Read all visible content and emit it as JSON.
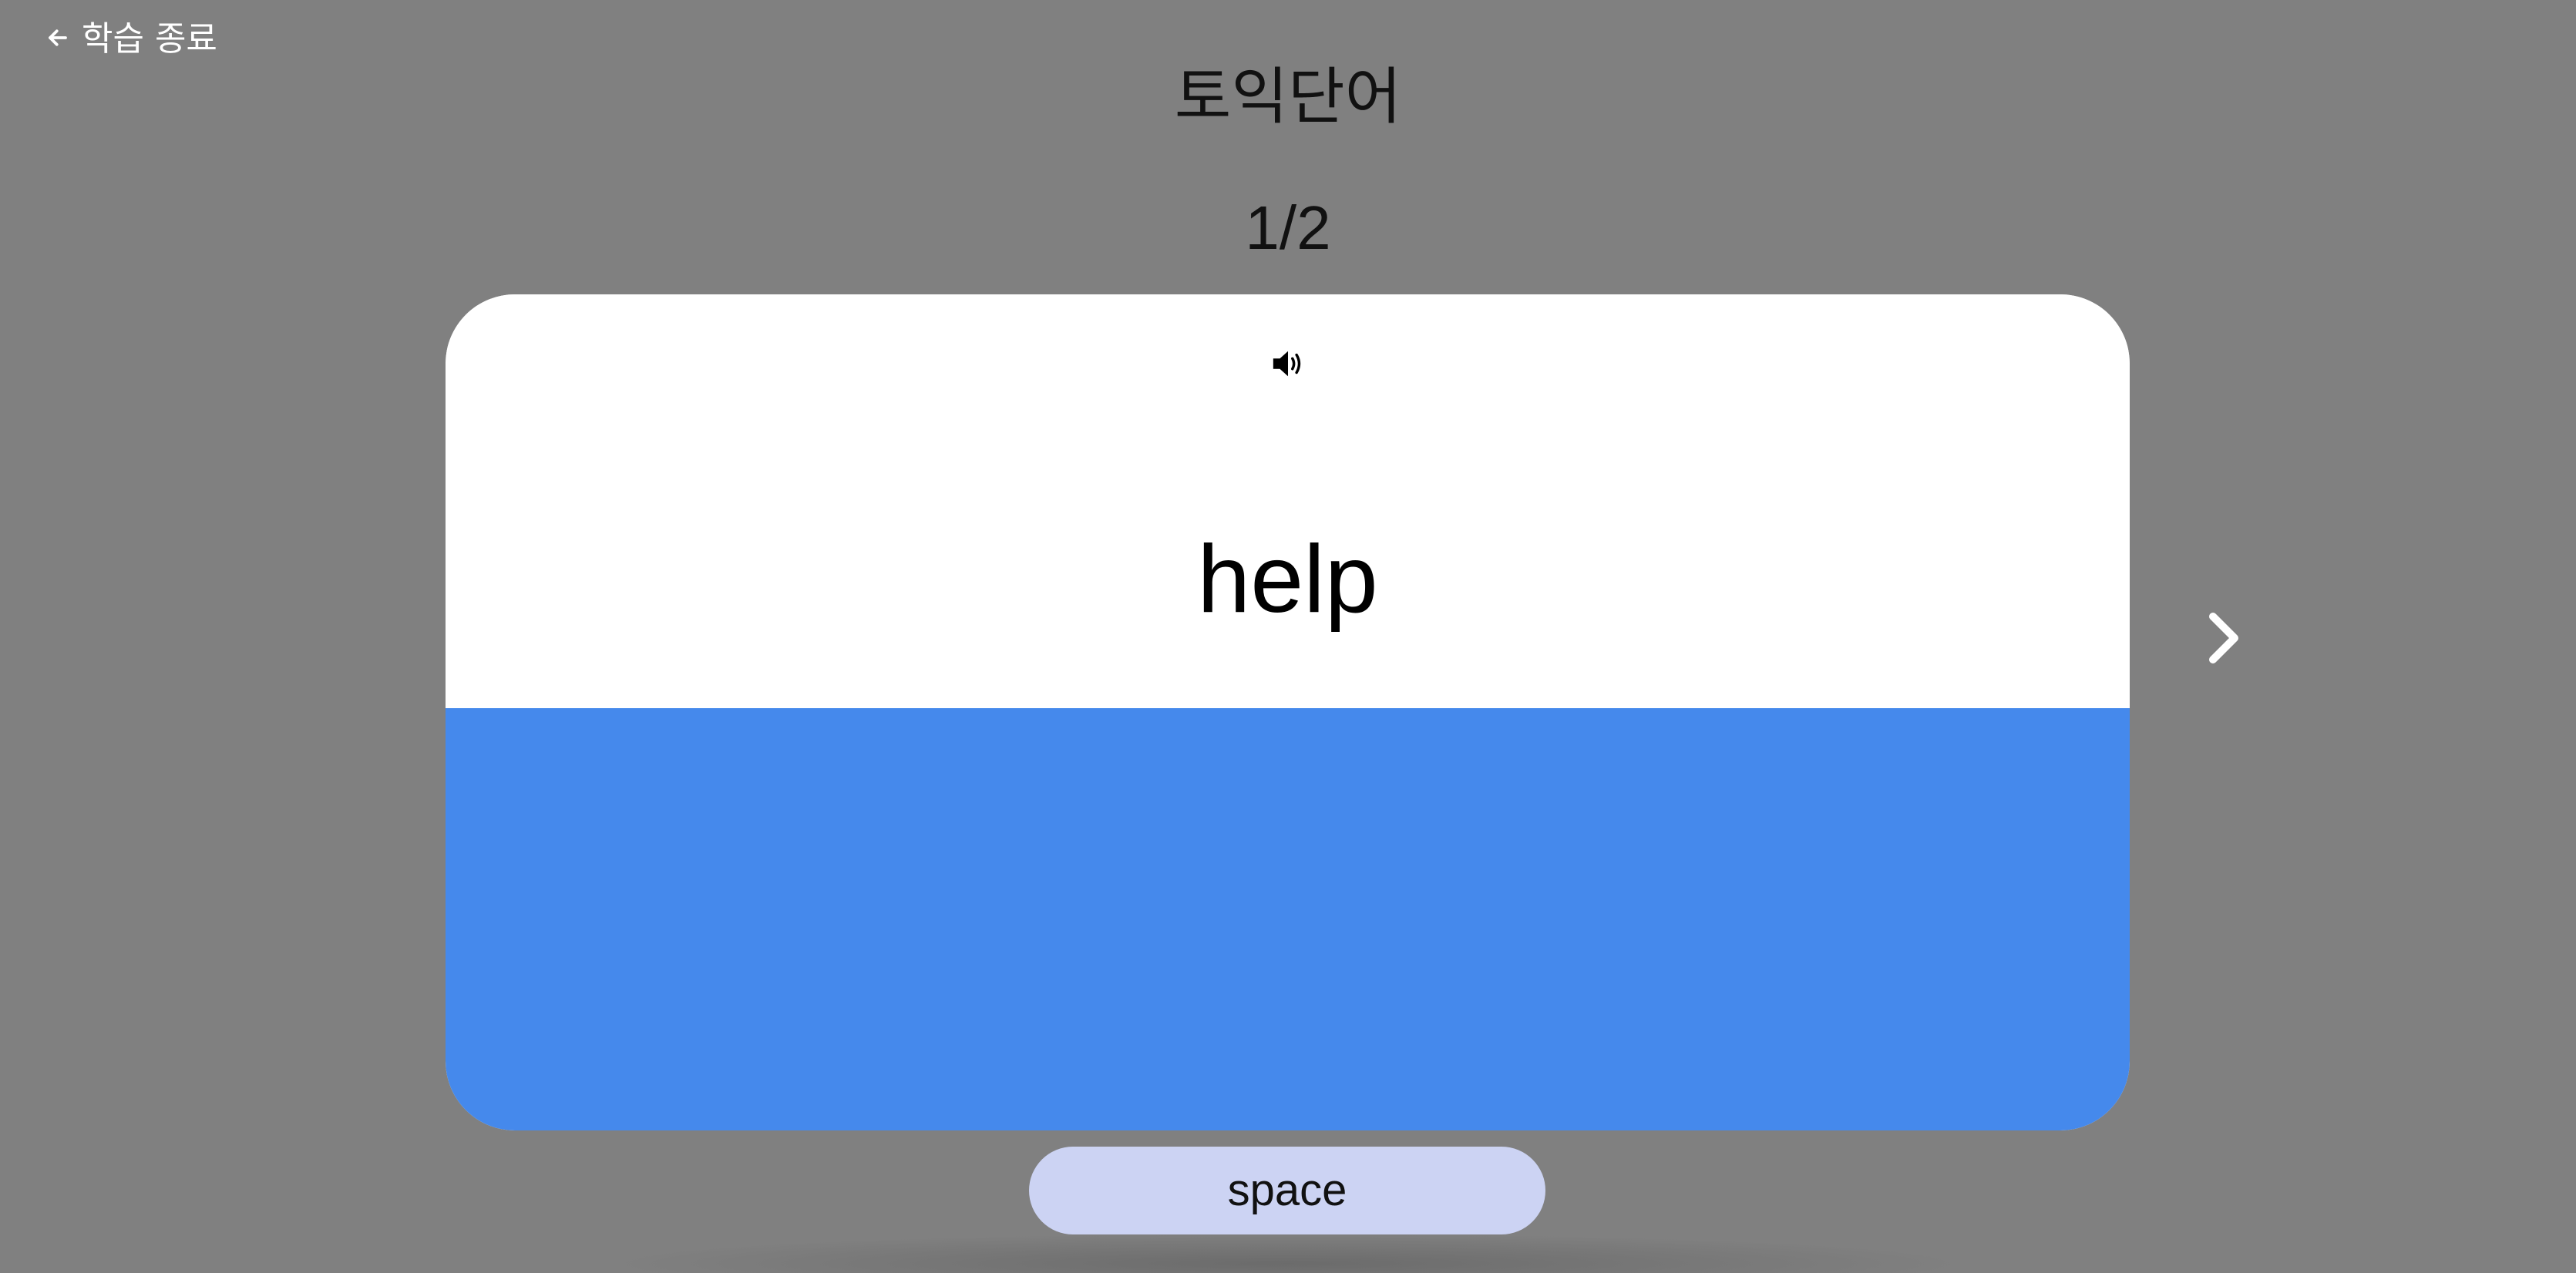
{
  "nav": {
    "back_label": "학습 종료",
    "back_icon": "arrow-left-icon"
  },
  "deck": {
    "title": "토익단어"
  },
  "progress": {
    "counter": "1/2",
    "current": 1,
    "total": 2
  },
  "card": {
    "word": "help",
    "sound_icon": "speaker-icon",
    "answer_text": "",
    "colors": {
      "front": "#ffffff",
      "back": "#4589ec"
    }
  },
  "controls": {
    "next_icon": "chevron-right-icon",
    "space_label": "space"
  },
  "colors": {
    "background": "#808080",
    "space_button": "#ccd3f3"
  }
}
